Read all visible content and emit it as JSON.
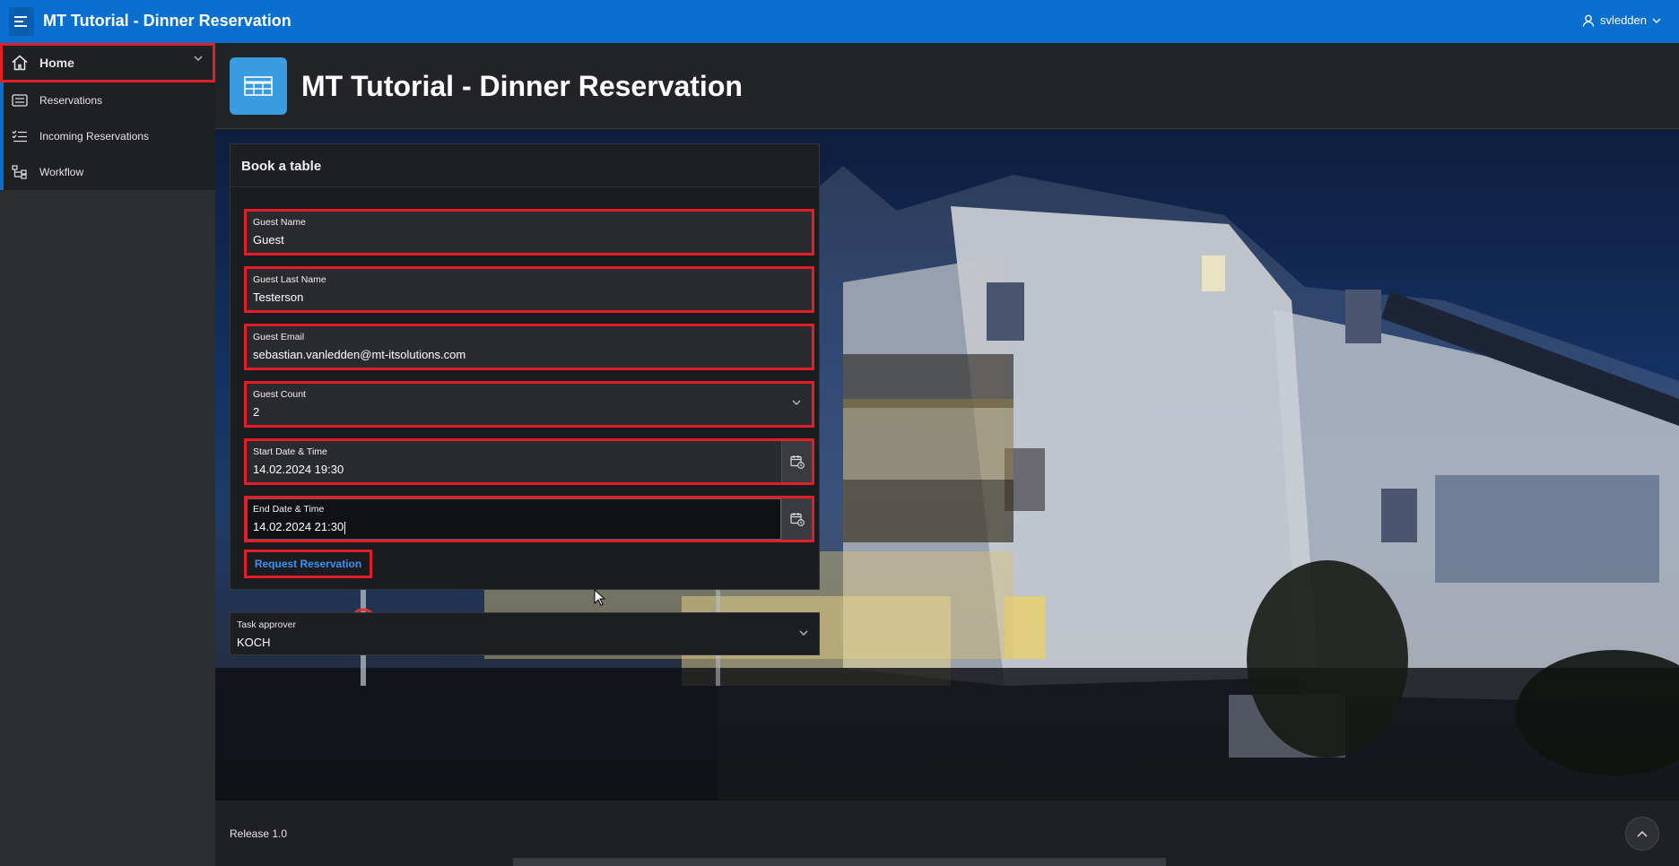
{
  "app": {
    "title": "MT Tutorial - Dinner Reservation"
  },
  "user": {
    "name": "svledden"
  },
  "sidebar": {
    "items": [
      {
        "label": "Home",
        "icon": "home-icon"
      },
      {
        "label": "Reservations",
        "icon": "list-icon"
      },
      {
        "label": "Incoming Reservations",
        "icon": "checklist-icon"
      },
      {
        "label": "Workflow",
        "icon": "workflow-icon"
      }
    ]
  },
  "page": {
    "title": "MT Tutorial - Dinner Reservation"
  },
  "form": {
    "heading": "Book a table",
    "fields": [
      {
        "label": "Guest Name",
        "value": "Guest"
      },
      {
        "label": "Guest Last Name",
        "value": "Testerson"
      },
      {
        "label": "Guest Email",
        "value": "sebastian.vanledden@mt-itsolutions.com"
      },
      {
        "label": "Guest Count",
        "value": "2"
      },
      {
        "label": "Start Date & Time",
        "value": "14.02.2024 19:30"
      },
      {
        "label": "End Date & Time",
        "value": "14.02.2024 21:30"
      }
    ],
    "submit_label": "Request Reservation"
  },
  "approver": {
    "label": "Task approver",
    "value": "KOCH"
  },
  "footer": {
    "release": "Release 1.0"
  },
  "colors": {
    "header": "#0b6fd0",
    "highlight": "#e31e24",
    "accent": "#3b92f0"
  }
}
